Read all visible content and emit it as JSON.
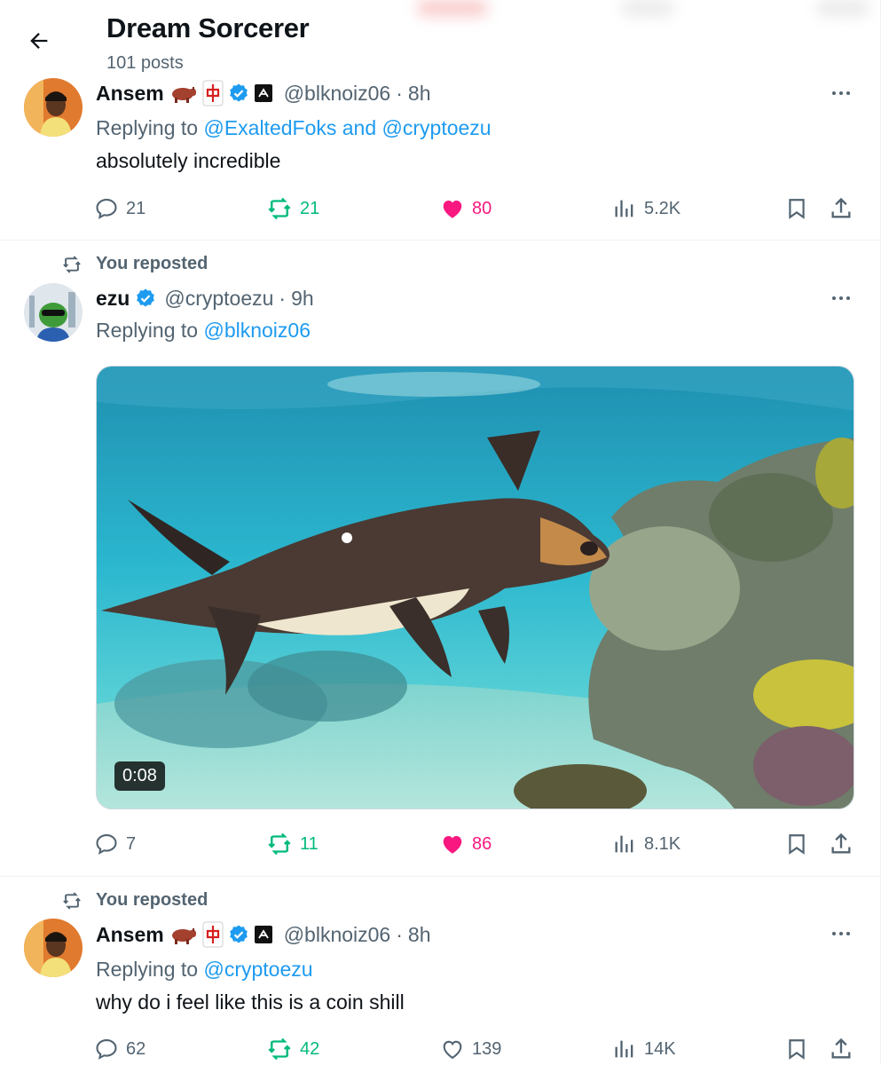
{
  "header": {
    "title": "Dream Sorcerer",
    "post_count": "101 posts"
  },
  "tweets": [
    {
      "name": "Ansem",
      "handle": "@blknoiz06",
      "separator": "·",
      "time": "8h",
      "replying_prefix": "Replying to",
      "reply_to": [
        "@ExaltedFoks",
        "@cryptoezu"
      ],
      "reply_joiner": "and",
      "text": "absolutely incredible",
      "stats": {
        "replies": "21",
        "reposts": "21",
        "likes": "80",
        "views": "5.2K"
      },
      "reposted_by_me": true,
      "liked_by_me": true
    },
    {
      "repost_label": "You reposted",
      "name": "ezu",
      "handle": "@cryptoezu",
      "separator": "·",
      "time": "9h",
      "replying_prefix": "Replying to",
      "reply_to": [
        "@blknoiz06"
      ],
      "video_duration": "0:08",
      "stats": {
        "replies": "7",
        "reposts": "11",
        "likes": "86",
        "views": "8.1K"
      },
      "reposted_by_me": true,
      "liked_by_me": true
    },
    {
      "repost_label": "You reposted",
      "name": "Ansem",
      "handle": "@blknoiz06",
      "separator": "·",
      "time": "8h",
      "replying_prefix": "Replying to",
      "reply_to": [
        "@cryptoezu"
      ],
      "text": "why do i feel like this is a coin shill",
      "stats": {
        "replies": "62",
        "reposts": "42",
        "likes": "139",
        "views": "14K"
      },
      "reposted_by_me": true,
      "liked_by_me": false
    }
  ],
  "colors": {
    "link": "#1d9bf0",
    "repost_green": "#00ba7c",
    "like_pink": "#f91880",
    "muted": "#536471",
    "verified": "#1d9bf0"
  },
  "icons": {
    "name_badges": [
      "cow-icon",
      "mahjong-red-dragon-icon",
      "verified-badge-icon",
      "affiliate-badge-icon"
    ]
  }
}
